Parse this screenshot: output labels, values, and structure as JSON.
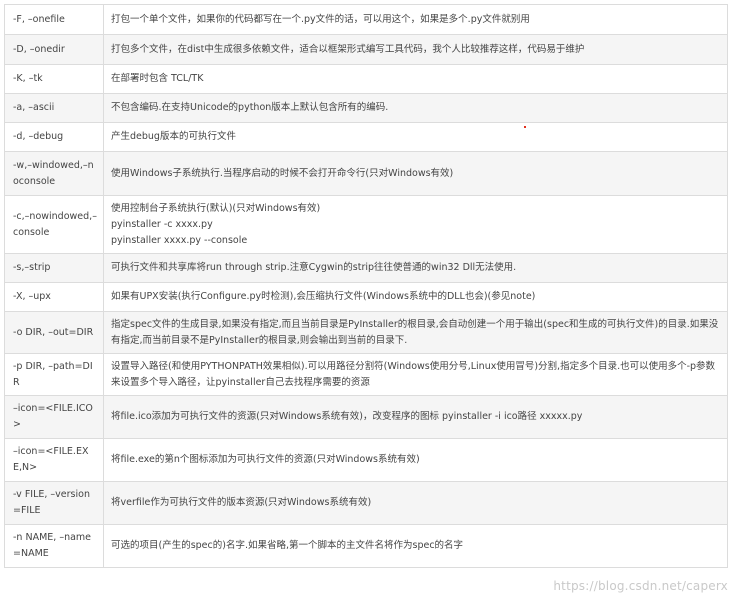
{
  "rows": [
    {
      "option": "-F, –onefile",
      "description": "打包一个单个文件，如果你的代码都写在一个.py文件的话，可以用这个，如果是多个.py文件就别用"
    },
    {
      "option": "-D, –onedir",
      "description": "打包多个文件，在dist中生成很多依赖文件，适合以框架形式编写工具代码，我个人比较推荐这样，代码易于维护"
    },
    {
      "option": "-K, –tk",
      "description": "在部署时包含 TCL/TK"
    },
    {
      "option": "-a, –ascii",
      "description": "不包含编码.在支持Unicode的python版本上默认包含所有的编码."
    },
    {
      "option": "-d, –debug",
      "description": "产生debug版本的可执行文件"
    },
    {
      "option": "-w,–windowed,–noconsole",
      "description": "使用Windows子系统执行.当程序启动的时候不会打开命令行(只对Windows有效)"
    },
    {
      "option": "-c,–nowindowed,–console",
      "description_lines": [
        "使用控制台子系统执行(默认)(只对Windows有效)",
        "pyinstaller -c  xxxx.py",
        "pyinstaller xxxx.py --console"
      ]
    },
    {
      "option": "-s,–strip",
      "description": "可执行文件和共享库将run through strip.注意Cygwin的strip往往使普通的win32 Dll无法使用."
    },
    {
      "option": "-X, –upx",
      "description": "如果有UPX安装(执行Configure.py时检测),会压缩执行文件(Windows系统中的DLL也会)(参见note)"
    },
    {
      "option": "-o DIR, –out=DIR",
      "description": "指定spec文件的生成目录,如果没有指定,而且当前目录是PyInstaller的根目录,会自动创建一个用于输出(spec和生成的可执行文件)的目录.如果没有指定,而当前目录不是PyInstaller的根目录,则会输出到当前的目录下."
    },
    {
      "option": "-p DIR, –path=DIR",
      "description": "设置导入路径(和使用PYTHONPATH效果相似).可以用路径分割符(Windows使用分号,Linux使用冒号)分割,指定多个目录.也可以使用多个-p参数来设置多个导入路径，让pyinstaller自己去找程序需要的资源"
    },
    {
      "option": "–icon=<FILE.ICO>",
      "description": "将file.ico添加为可执行文件的资源(只对Windows系统有效)，改变程序的图标  pyinstaller -i  ico路径 xxxxx.py"
    },
    {
      "option": "–icon=<FILE.EXE,N>",
      "description": "将file.exe的第n个图标添加为可执行文件的资源(只对Windows系统有效)"
    },
    {
      "option": "-v FILE, –version=FILE",
      "description": "将verfile作为可执行文件的版本资源(只对Windows系统有效)"
    },
    {
      "option": "-n NAME, –name=NAME",
      "description": "可选的项目(产生的spec的)名字.如果省略,第一个脚本的主文件名将作为spec的名字"
    }
  ],
  "watermark": "https://blog.csdn.net/caperx"
}
